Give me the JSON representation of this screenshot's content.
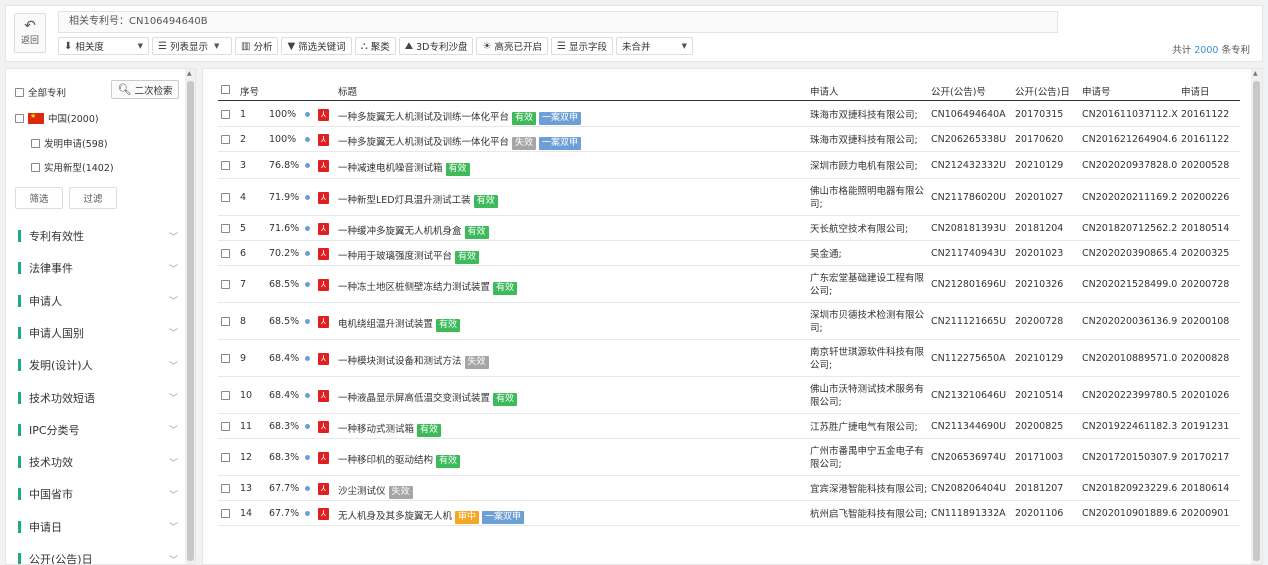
{
  "toolbar": {
    "back_label": "返回",
    "related": "相关专利号：CN106494640B",
    "sort": "相关度",
    "list_view": "列表显示",
    "analyze": "分析",
    "filter_keywords": "筛选关键词",
    "cluster": "聚类",
    "sandbox": "3D专利沙盘",
    "highlight": "高亮已开启",
    "fields": "显示字段",
    "merge": "未合并",
    "total_prefix": "共计",
    "total_count": "2000",
    "total_suffix": "条专利"
  },
  "left": {
    "all_patents": "全部专利",
    "second_search": "二次检索",
    "china": "中国(2000)",
    "invention": "发明申请(598)",
    "utility": "实用新型(1402)",
    "filter_btn": "筛选",
    "exclude_btn": "过滤",
    "facets": [
      "专利有效性",
      "法律事件",
      "申请人",
      "申请人国别",
      "发明(设计)人",
      "技术功效短语",
      "IPC分类号",
      "技术功效",
      "中国省市",
      "申请日",
      "公开(公告)日"
    ]
  },
  "table": {
    "headers": {
      "seq": "序号",
      "title": "标题",
      "applicant": "申请人",
      "pub_no": "公开(公告)号",
      "pub_date": "公开(公告)日",
      "app_no": "申请号",
      "app_date": "申请日"
    },
    "rows": [
      {
        "seq": "1",
        "score": "100%",
        "title": "一种多旋翼无人机测试及训练一体化平台",
        "tags": [
          {
            "t": "有效",
            "c": "valid"
          },
          {
            "t": "一案双申",
            "c": "dual"
          }
        ],
        "applicant": "珠海市双捷科技有限公司;",
        "pub_no": "CN106494640A",
        "pub_date": "20170315",
        "app_no": "CN201611037112.X",
        "app_date": "20161122"
      },
      {
        "seq": "2",
        "score": "100%",
        "title": "一种多旋翼无人机测试及训练一体化平台",
        "tags": [
          {
            "t": "失效",
            "c": "invalid"
          },
          {
            "t": "一案双申",
            "c": "dual"
          }
        ],
        "applicant": "珠海市双捷科技有限公司;",
        "pub_no": "CN206265338U",
        "pub_date": "20170620",
        "app_no": "CN201621264904.6",
        "app_date": "20161122"
      },
      {
        "seq": "3",
        "score": "76.8%",
        "title": "一种减速电机噪音测试箱",
        "tags": [
          {
            "t": "有效",
            "c": "valid"
          }
        ],
        "applicant": "深圳市顾力电机有限公司;",
        "pub_no": "CN212432332U",
        "pub_date": "20210129",
        "app_no": "CN202020937828.0",
        "app_date": "20200528"
      },
      {
        "seq": "4",
        "score": "71.9%",
        "title": "一种新型LED灯具温升测试工装",
        "tags": [
          {
            "t": "有效",
            "c": "valid"
          }
        ],
        "applicant": "佛山市格能照明电器有限公司;",
        "pub_no": "CN211786020U",
        "pub_date": "20201027",
        "app_no": "CN202020211169.2",
        "app_date": "20200226"
      },
      {
        "seq": "5",
        "score": "71.6%",
        "title": "一种缓冲多旋翼无人机机身盒",
        "tags": [
          {
            "t": "有效",
            "c": "valid"
          }
        ],
        "applicant": "天长航空技术有限公司;",
        "pub_no": "CN208181393U",
        "pub_date": "20181204",
        "app_no": "CN201820712562.2",
        "app_date": "20180514"
      },
      {
        "seq": "6",
        "score": "70.2%",
        "title": "一种用于玻璃强度测试平台",
        "tags": [
          {
            "t": "有效",
            "c": "valid"
          }
        ],
        "applicant": "吴金通;",
        "pub_no": "CN211740943U",
        "pub_date": "20201023",
        "app_no": "CN202020390865.4",
        "app_date": "20200325"
      },
      {
        "seq": "7",
        "score": "68.5%",
        "title": "一种冻土地区桩侧壁冻结力测试装置",
        "tags": [
          {
            "t": "有效",
            "c": "valid"
          }
        ],
        "applicant": "广东宏堂基础建设工程有限公司;",
        "pub_no": "CN212801696U",
        "pub_date": "20210326",
        "app_no": "CN202021528499.0",
        "app_date": "20200728"
      },
      {
        "seq": "8",
        "score": "68.5%",
        "title": "电机绕组温升测试装置",
        "tags": [
          {
            "t": "有效",
            "c": "valid"
          }
        ],
        "applicant": "深圳市贝德技术检测有限公司;",
        "pub_no": "CN211121665U",
        "pub_date": "20200728",
        "app_no": "CN202020036136.9",
        "app_date": "20200108"
      },
      {
        "seq": "9",
        "score": "68.4%",
        "title": "一种模块测试设备和测试方法",
        "tags": [
          {
            "t": "失效",
            "c": "invalid"
          }
        ],
        "applicant": "南京轩世琪源软件科技有限公司;",
        "pub_no": "CN112275650A",
        "pub_date": "20210129",
        "app_no": "CN202010889571.0",
        "app_date": "20200828"
      },
      {
        "seq": "10",
        "score": "68.4%",
        "title": "一种液晶显示屏高低温交变测试装置",
        "tags": [
          {
            "t": "有效",
            "c": "valid"
          }
        ],
        "applicant": "佛山市沃特测试技术服务有限公司;",
        "pub_no": "CN213210646U",
        "pub_date": "20210514",
        "app_no": "CN202022399780.5",
        "app_date": "20201026"
      },
      {
        "seq": "11",
        "score": "68.3%",
        "title": "一种移动式测试箱",
        "tags": [
          {
            "t": "有效",
            "c": "valid"
          }
        ],
        "applicant": "江苏胜广捷电气有限公司;",
        "pub_no": "CN211344690U",
        "pub_date": "20200825",
        "app_no": "CN201922461182.3",
        "app_date": "20191231"
      },
      {
        "seq": "12",
        "score": "68.3%",
        "title": "一种移印机的驱动结构",
        "tags": [
          {
            "t": "有效",
            "c": "valid"
          }
        ],
        "applicant": "广州市番禺申宁五金电子有限公司;",
        "pub_no": "CN206536974U",
        "pub_date": "20171003",
        "app_no": "CN201720150307.9",
        "app_date": "20170217"
      },
      {
        "seq": "13",
        "score": "67.7%",
        "title": "沙尘测试仪",
        "tags": [
          {
            "t": "失效",
            "c": "invalid"
          }
        ],
        "applicant": "宜宾深港智能科技有限公司;",
        "pub_no": "CN208206404U",
        "pub_date": "20181207",
        "app_no": "CN201820923229.6",
        "app_date": "20180614"
      },
      {
        "seq": "14",
        "score": "67.7%",
        "title": "无人机身及其多旋翼无人机",
        "tags": [
          {
            "t": "审中",
            "c": "pending"
          },
          {
            "t": "一案双申",
            "c": "dual"
          }
        ],
        "applicant": "杭州启飞智能科技有限公司;",
        "pub_no": "CN111891332A",
        "pub_date": "20201106",
        "app_no": "CN202010901889.6",
        "app_date": "20200901"
      }
    ]
  }
}
